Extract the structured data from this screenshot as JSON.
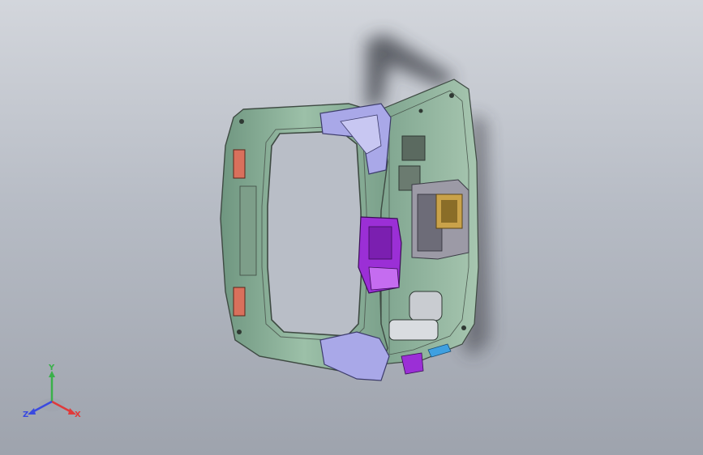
{
  "viewport": {
    "background_top": "#d3d6dc",
    "background_bottom": "#9ea3ad"
  },
  "model": {
    "frame_color": "#8fb39a",
    "frame_edge_color": "#3e4a42",
    "highlight_lavender": "#a9a8e8",
    "highlight_purple": "#9b2fd6",
    "pad_color": "#d9705c",
    "plate_color": "#c9a24a",
    "accent_blue": "#3fa0e0",
    "shadow_color": "#3a3d44"
  },
  "triad": {
    "x_label": "X",
    "y_label": "Y",
    "z_label": "Z",
    "x_color": "#e03a3a",
    "y_color": "#3ab04a",
    "z_color": "#3a4ae0"
  }
}
